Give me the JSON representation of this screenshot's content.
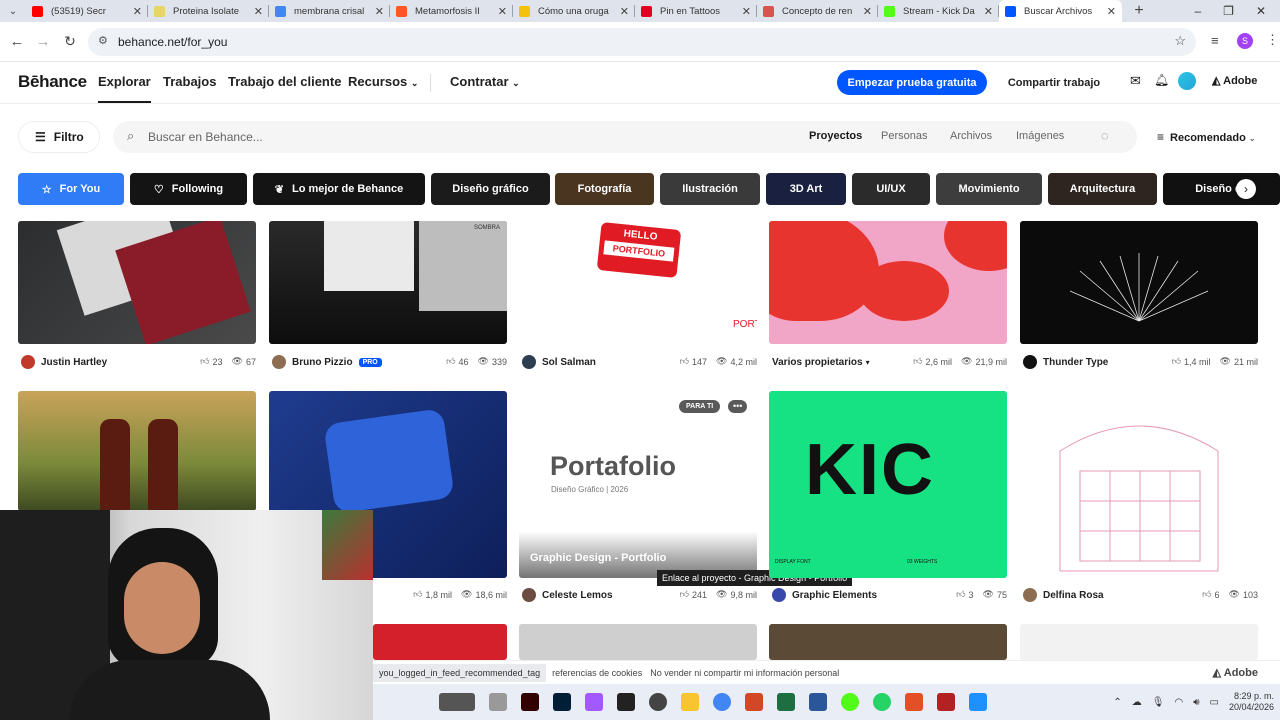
{
  "browser": {
    "tabs": [
      {
        "title": "(53519) Secr",
        "color": "#ff0000"
      },
      {
        "title": "Proteina Isolate",
        "color": "#e8d46a"
      },
      {
        "title": "membrana crisal",
        "color": "#4285f4"
      },
      {
        "title": "Metamorfosis II",
        "color": "#ff5722"
      },
      {
        "title": "Cómo una oruga",
        "color": "#f4c20d"
      },
      {
        "title": "Pin en Tattoos",
        "color": "#e60023"
      },
      {
        "title": "Concepto de ren",
        "color": "#d9534f"
      },
      {
        "title": "Stream - Kick Da",
        "color": "#53fc18"
      },
      {
        "title": "Buscar Archivos",
        "color": "#0057ff"
      }
    ],
    "url": "behance.net/for_you",
    "profile_initial": "S"
  },
  "header": {
    "logo": "Bēhance",
    "nav": [
      "Explorar",
      "Trabajos",
      "Trabajo del cliente",
      "Recursos",
      "Contratar"
    ],
    "trial_button": "Empezar prueba gratuita",
    "share_button": "Compartir trabajo",
    "adobe_label": "Adobe"
  },
  "search": {
    "filter_label": "Filtro",
    "placeholder": "Buscar en Behance...",
    "types": [
      "Proyectos",
      "Personas",
      "Archivos",
      "Imágenes"
    ],
    "sort_label": "Recomendado"
  },
  "categories": [
    {
      "label": "For You",
      "color": "#2f7cf6"
    },
    {
      "label": "Following",
      "color": "#141414"
    },
    {
      "label": "Lo mejor de Behance",
      "color": "#141414"
    },
    {
      "label": "Diseño gráfico",
      "color": "#1b1b1b"
    },
    {
      "label": "Fotografía",
      "color": "#4a3520"
    },
    {
      "label": "Ilustración",
      "color": "#3a3a3a"
    },
    {
      "label": "3D Art",
      "color": "#1a2140"
    },
    {
      "label": "UI/UX",
      "color": "#2b2b2b"
    },
    {
      "label": "Movimiento",
      "color": "#3d3d3d"
    },
    {
      "label": "Arquitectura",
      "color": "#2e2520"
    },
    {
      "label": "Diseño de",
      "color": "#111111"
    }
  ],
  "projects_row1": [
    {
      "owner": "Justin Hartley",
      "likes": "23",
      "views": "67",
      "pro": ""
    },
    {
      "owner": "Bruno Pizzio",
      "likes": "46",
      "views": "339",
      "pro": "PRO"
    },
    {
      "owner": "Sol Salman",
      "likes": "147",
      "views": "4,2 mil",
      "pro": ""
    },
    {
      "owner": "Varios propietarios",
      "likes": "2,6 mil",
      "views": "21,9 mil",
      "pro": ""
    },
    {
      "owner": "Thunder Type",
      "likes": "1,4 mil",
      "views": "21 mil",
      "pro": ""
    }
  ],
  "projects_row2": [
    {
      "owner": "",
      "likes": "",
      "views": ""
    },
    {
      "owner": "",
      "likes": "1,8 mil",
      "views": "18,6 mil"
    },
    {
      "owner": "Celeste Lemos",
      "likes": "241",
      "views": "9,8 mil"
    },
    {
      "owner": "Graphic Elements",
      "likes": "3",
      "views": "75"
    },
    {
      "owner": "Delfina Rosa",
      "likes": "6",
      "views": "103"
    }
  ],
  "thumb_text": {
    "hello": "HELLO",
    "portfolio_sticker": "PORTFOLIO",
    "port": "PORT",
    "sombra": "SOMBRA",
    "para_ti": "PARA TI",
    "portafolio": "Portafolio",
    "portafolio_sub": "Diseño Gráfico | 2026",
    "hover_title": "Graphic Design - Portfolio",
    "tooltip": "Enlace al proyecto - Graphic Design - Portfolio",
    "kic": "KIC",
    "display_font": "DISPLAY FONT",
    "weights": "03 WEIGHTS"
  },
  "footer": {
    "status_url": "you_logged_in_feed_recommended_tag",
    "cookies": "referencias de cookies",
    "no_sell": "No vender ni compartir mi información personal",
    "adobe": "Adobe"
  },
  "taskbar": {
    "time": "8:29 p. m.",
    "date": "20/04/2026"
  }
}
